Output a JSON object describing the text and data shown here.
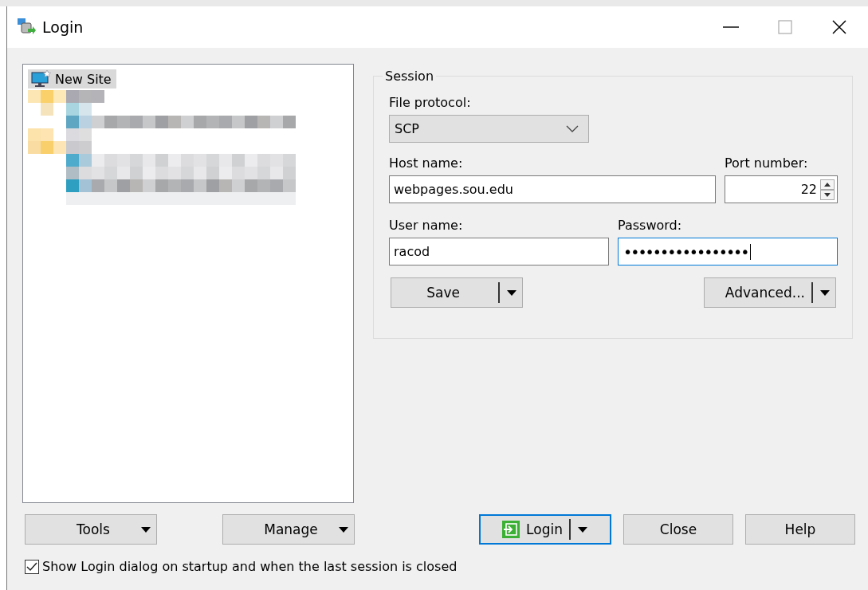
{
  "window": {
    "title": "Login"
  },
  "site_tree": {
    "items": [
      {
        "label": "New Site",
        "selected": true
      }
    ]
  },
  "session": {
    "title": "Session",
    "protocol_label": "File protocol:",
    "protocol": "SCP",
    "host_label": "Host name:",
    "host": "webpages.sou.edu",
    "port_label": "Port number:",
    "port": "22",
    "user_label": "User name:",
    "user": "racod",
    "password_label": "Password:",
    "password": "•••••••••••••••••",
    "password_focused": true,
    "buttons": [
      {
        "label": "Save",
        "kind": "split"
      },
      {
        "label": "Advanced...",
        "kind": "split"
      }
    ]
  },
  "left_buttons": [
    {
      "label": "Tools",
      "kind": "menu"
    },
    {
      "label": "Manage",
      "kind": "menu"
    }
  ],
  "dialog_buttons": [
    {
      "label": "Login",
      "kind": "split",
      "default": true
    },
    {
      "label": "Close",
      "kind": "plain",
      "default": false
    },
    {
      "label": "Help",
      "kind": "plain",
      "default": false
    }
  ],
  "startup_option": {
    "label": "Show Login dialog on startup and when the last session is closed",
    "checked": true
  }
}
